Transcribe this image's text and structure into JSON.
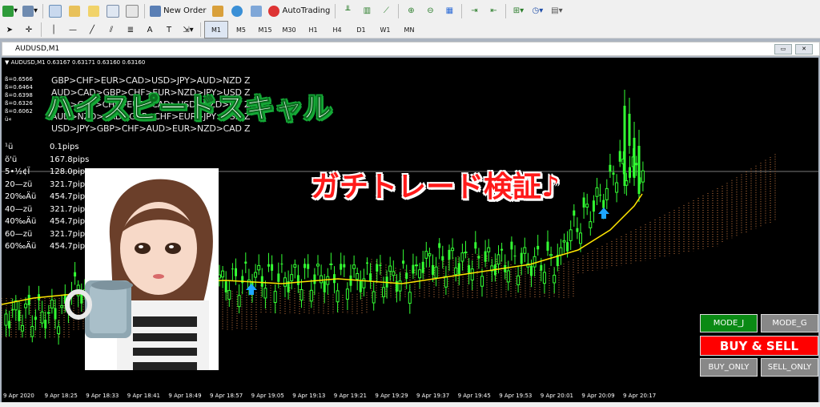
{
  "toolbar1": {
    "new_order_label": "New Order",
    "autotrading_label": "AutoTrading"
  },
  "toolbar2": {
    "timeframes": [
      "M1",
      "M5",
      "M15",
      "M30",
      "H1",
      "H4",
      "D1",
      "W1",
      "MN"
    ],
    "active_timeframe": "M1"
  },
  "window": {
    "title": "AUDUSD,M1"
  },
  "chart": {
    "info_line": "▼ AUDUSD,M1  0.63167 0.63171 0.63160 0.63160",
    "sequences": [
      "GBP>CHF>EUR>CAD>USD>JPY>AUD>NZD Z",
      "AUD>CAD>GBP>CHF>EUR>NZD>JPY>USD Z",
      "AUD>GBP>CHF>EUR>CAD>USD>NZD>JPY Z",
      "AUD>NZD>CAD>GBP>CHF>EUR>JPY>USD Z",
      "USD>JPY>GBP>CHF>AUD>EUR>NZD>CAD Z"
    ],
    "left_codes": [
      "ß=0.6566",
      "ß=0.6464",
      "ß=0.6398",
      "ß=0.6326",
      "ß=0.6062",
      "ü«"
    ],
    "rows": [
      {
        "label": "¹ü",
        "value": "0.1pips"
      },
      {
        "label": "õ'ü",
        "value": "167.8pips"
      },
      {
        "label": "5•½¢Ï",
        "value": "128.0pips"
      },
      {
        "label": "20—zü",
        "value": "321.7pips"
      },
      {
        "label": "20‰Äü",
        "value": "454.7pips"
      },
      {
        "label": "40—zü",
        "value": "321.7pips"
      },
      {
        "label": "40‰Äü",
        "value": "454.7pips"
      },
      {
        "label": "60—zü",
        "value": "321.7pips"
      },
      {
        "label": "60‰Äü",
        "value": "454.7pips"
      }
    ],
    "x_labels": [
      "9 Apr 2020",
      "9 Apr 18:25",
      "9 Apr 18:33",
      "9 Apr 18:41",
      "9 Apr 18:49",
      "9 Apr 18:57",
      "9 Apr 19:05",
      "9 Apr 19:13",
      "9 Apr 19:21",
      "9 Apr 19:29",
      "9 Apr 19:37",
      "9 Apr 19:45",
      "9 Apr 19:53",
      "9 Apr 20:01",
      "9 Apr 20:09",
      "9 Apr 20:17"
    ]
  },
  "overlay": {
    "title_main": "ハイスピードスキャル",
    "title_sub": "ガチトレード検証♪"
  },
  "panel": {
    "mode_j": "MODE_J",
    "mode_g": "MODE_G",
    "buy_sell": "BUY & SELL",
    "buy_only": "BUY_ONLY",
    "sell_only": "SELL_ONLY"
  },
  "colors": {
    "chart_bg": "#000000",
    "bull_candle": "#33ff33",
    "ma_line": "#ffe600",
    "cloud": "#c87840",
    "signal_arrow": "#1ea7ff",
    "mode_active": "#0a8a14",
    "buy_sell": "#ff0000"
  }
}
